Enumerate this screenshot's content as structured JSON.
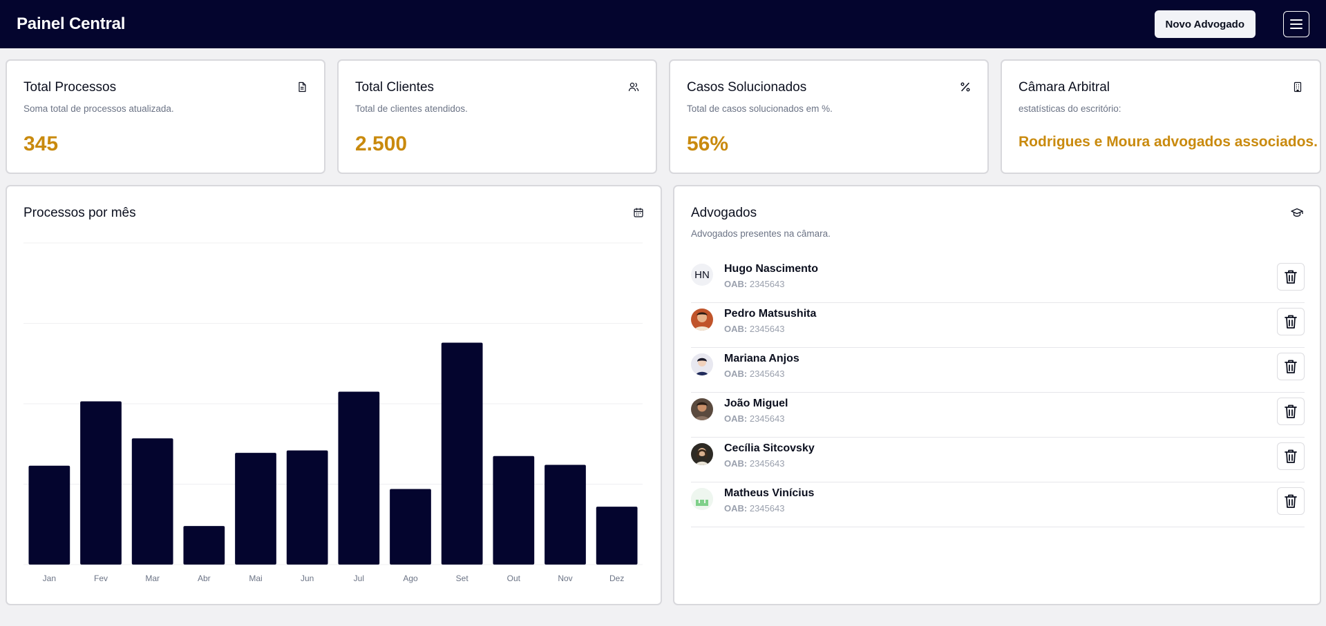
{
  "header": {
    "brand": "Painel Central",
    "new_button": "Novo Advogado"
  },
  "stats": [
    {
      "title": "Total Processos",
      "desc": "Soma total de processos atualizada.",
      "value": "345",
      "icon": "file-icon"
    },
    {
      "title": "Total Clientes",
      "desc": "Total de clientes atendidos.",
      "value": "2.500",
      "icon": "users-icon"
    },
    {
      "title": "Casos Solucionados",
      "desc": "Total de casos solucionados em %.",
      "value": "56%",
      "icon": "percent-icon"
    },
    {
      "title": "Câmara Arbitral",
      "desc": "estatísticas do escritório:",
      "value": "Rodrigues e Moura advogados associados.",
      "icon": "building-icon"
    }
  ],
  "chart_panel": {
    "title": "Processos por mês"
  },
  "chart_data": {
    "type": "bar",
    "title": "Processos por mês",
    "categories": [
      "Jan",
      "Fev",
      "Mar",
      "Abr",
      "Mai",
      "Jun",
      "Jul",
      "Ago",
      "Set",
      "Out",
      "Nov",
      "Dez"
    ],
    "values": [
      123,
      203,
      157,
      48,
      139,
      142,
      215,
      94,
      276,
      135,
      124,
      72
    ],
    "ylim": [
      0,
      400
    ],
    "grid": true,
    "color": "#04052e"
  },
  "lawyers_panel": {
    "title": "Advogados",
    "desc": "Advogados presentes na câmara.",
    "oab_label": "OAB:",
    "items": [
      {
        "name": "Hugo Nascimento",
        "oab": "2345643",
        "initials": "HN"
      },
      {
        "name": "Pedro Matsushita",
        "oab": "2345643",
        "initials": ""
      },
      {
        "name": "Mariana Anjos",
        "oab": "2345643",
        "initials": ""
      },
      {
        "name": "João Miguel",
        "oab": "2345643",
        "initials": ""
      },
      {
        "name": "Cecília Sitcovsky",
        "oab": "2345643",
        "initials": ""
      },
      {
        "name": "Matheus Vinícius",
        "oab": "2345643",
        "initials": ""
      }
    ]
  },
  "colors": {
    "navbar": "#04052e",
    "accent": "#c98a0e",
    "bar": "#04052e"
  }
}
